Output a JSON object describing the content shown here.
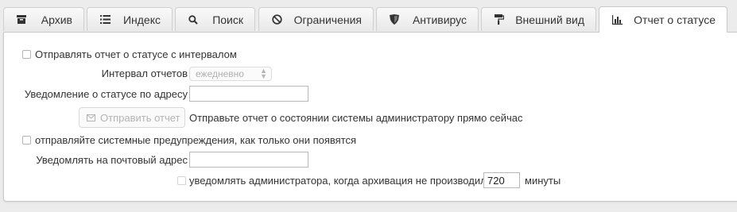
{
  "tabs": [
    {
      "label": "Архив",
      "icon": "archive-icon"
    },
    {
      "label": "Индекс",
      "icon": "list-icon"
    },
    {
      "label": "Поиск",
      "icon": "search-icon"
    },
    {
      "label": "Ограничения",
      "icon": "ban-icon"
    },
    {
      "label": "Антивирус",
      "icon": "shield-icon"
    },
    {
      "label": "Внешний вид",
      "icon": "paint-roller-icon"
    },
    {
      "label": "Отчет о статусе",
      "icon": "bar-chart-icon",
      "active": true
    }
  ],
  "status_report": {
    "send_interval_label": "Отправлять отчет о статусе с интервалом",
    "send_interval_checked": false,
    "interval_label": "Интервал отчетов",
    "interval_value": "ежедневно",
    "notify_address_label": "Уведомление о статусе по адресу",
    "notify_address_value": "",
    "send_button_label": "Отправить отчет",
    "send_now_text": "Отправьте отчет о состоянии системы администратору прямо сейчас"
  },
  "warnings": {
    "send_warnings_label": "отправляйте системные предупреждения, как только они появятся",
    "send_warnings_checked": false,
    "notify_email_label": "Уведомлять на почтовый адрес",
    "notify_email_value": "",
    "archive_notify_label": "уведомлять администратора, когда архивация не производилась",
    "archive_notify_checked": false,
    "archive_minutes_value": "720",
    "minutes_label": "минуты"
  }
}
